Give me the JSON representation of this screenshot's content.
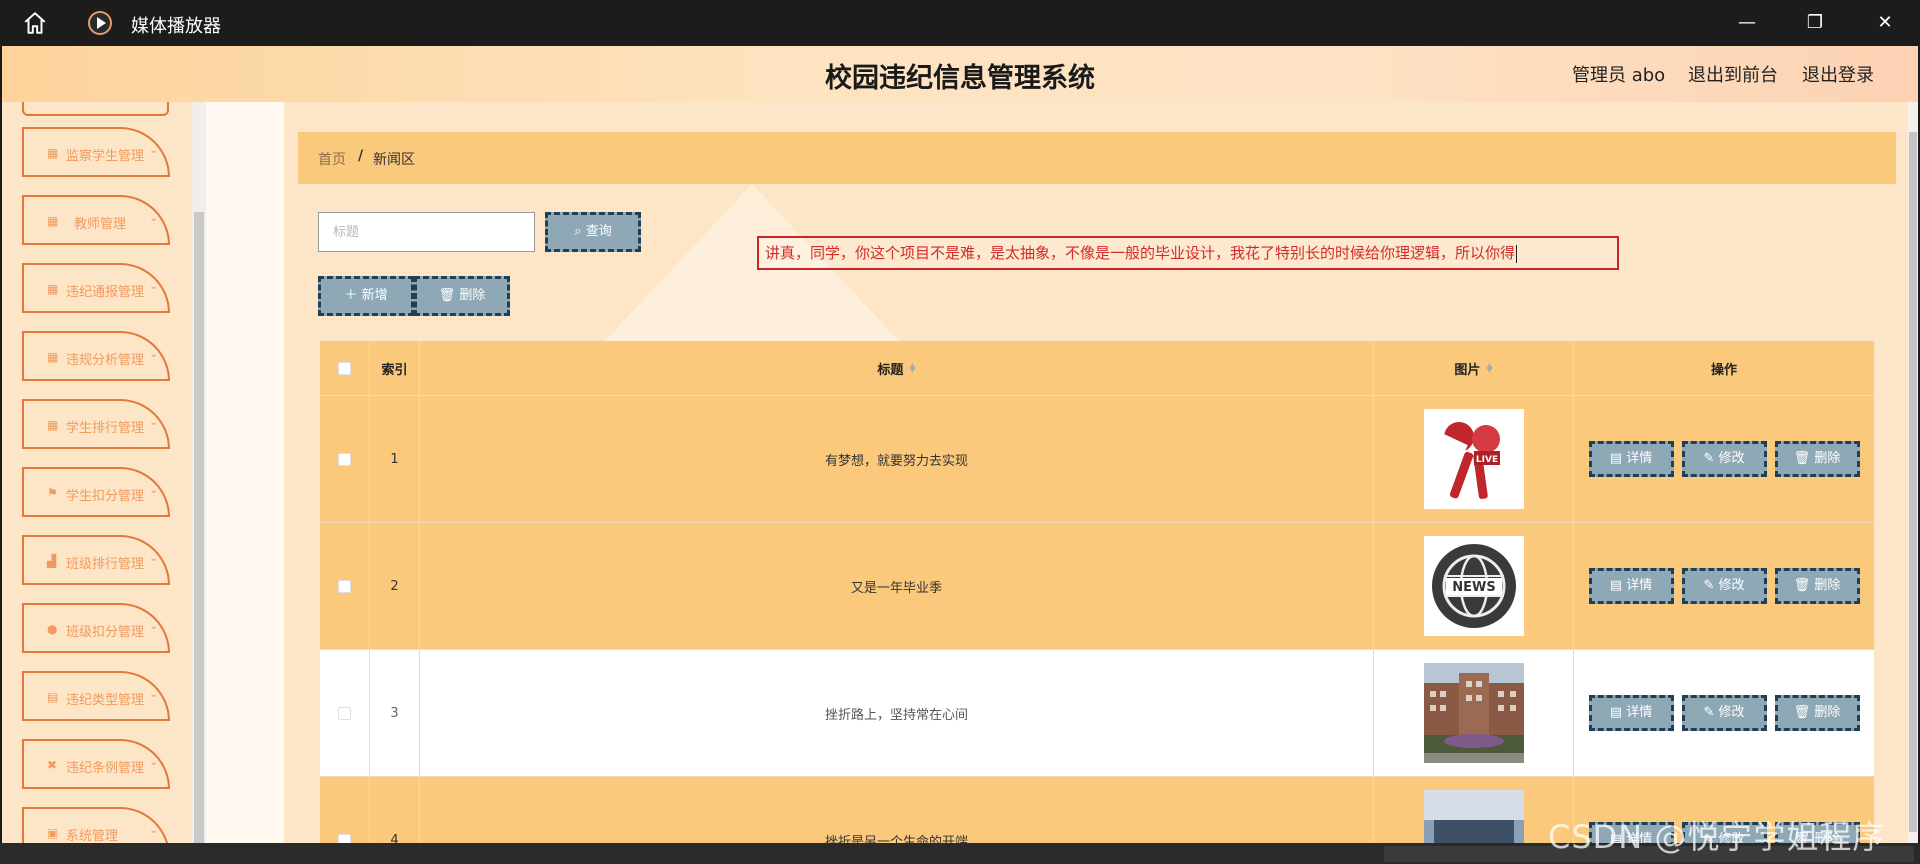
{
  "player": {
    "title": "媒体播放器",
    "home_icon": "home-icon",
    "logo_icon": "play-logo-icon",
    "controls": {
      "minimize": "—",
      "restore": "❐",
      "close": "✕"
    }
  },
  "header": {
    "title": "校园违纪信息管理系统",
    "admin": "管理员 abo",
    "to_front": "退出到前台",
    "logout": "退出登录"
  },
  "sidebar": {
    "items": [
      {
        "label": "监察学生管理",
        "icon": "grid-icon",
        "glyph": "▦"
      },
      {
        "label": "教师管理",
        "icon": "grid-icon",
        "glyph": "▦"
      },
      {
        "label": "违纪通报管理",
        "icon": "grid-icon",
        "glyph": "▦"
      },
      {
        "label": "违规分析管理",
        "icon": "grid-icon",
        "glyph": "▦"
      },
      {
        "label": "学生排行管理",
        "icon": "grid-icon",
        "glyph": "▦"
      },
      {
        "label": "学生扣分管理",
        "icon": "flag-icon",
        "glyph": "⚑"
      },
      {
        "label": "班级排行管理",
        "icon": "thumb-up-icon",
        "glyph": "▟"
      },
      {
        "label": "班级扣分管理",
        "icon": "location-icon",
        "glyph": "●"
      },
      {
        "label": "违纪类型管理",
        "icon": "clipboard-icon",
        "glyph": "▤"
      },
      {
        "label": "违纪条例管理",
        "icon": "ticket-icon",
        "glyph": "✖"
      },
      {
        "label": "系统管理",
        "icon": "settings-icon",
        "glyph": "▣"
      }
    ],
    "chevron": "⌄"
  },
  "breadcrumb": {
    "home": "首页",
    "sep": "/",
    "current": "新闻区"
  },
  "toolbar": {
    "search_placeholder": "标题",
    "query_label": "查询",
    "add_label": "新增",
    "delete_label": "删除"
  },
  "annotation": {
    "text": "讲真，同学，你这个项目不是难，是太抽象，不像是一般的毕业设计，我花了特别长的时候给你理逻辑，所以你得"
  },
  "table": {
    "headers": {
      "index": "索引",
      "title": "标题",
      "image": "图片",
      "ops": "操作"
    },
    "rows": [
      {
        "index": "1",
        "title": "有梦想，就要努力去实现",
        "image": "live-microphones",
        "selected_bg": "#fbc97b"
      },
      {
        "index": "2",
        "title": "又是一年毕业季",
        "image": "news-globe",
        "selected_bg": "#fbc97b"
      },
      {
        "index": "3",
        "title": "挫折路上，坚持常在心间",
        "image": "campus-building",
        "selected_bg": "#ffffff"
      },
      {
        "index": "4",
        "title": "挫折是另一个生命的开端",
        "image": "classroom",
        "selected_bg": "#fbc97b"
      }
    ],
    "ops": {
      "detail": "详情",
      "edit": "修改",
      "delete": "删除"
    }
  },
  "watermark": "CSDN @悦宁学姐程序"
}
